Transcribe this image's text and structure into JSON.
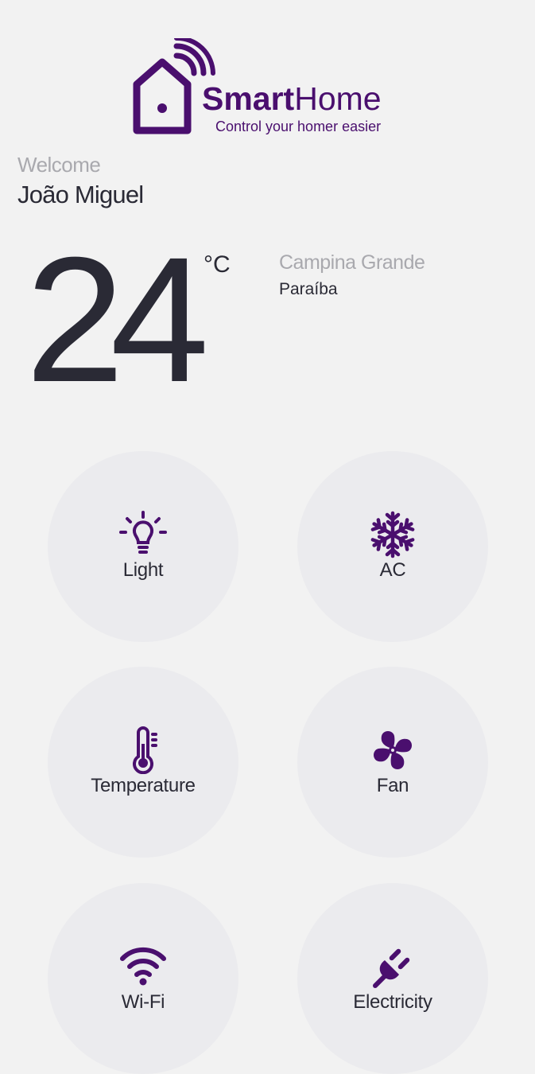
{
  "brand": {
    "name_bold": "Smart",
    "name_light": "Home",
    "tagline": "Control your homer easier",
    "color": "#4a0f6e"
  },
  "greeting": {
    "welcome": "Welcome",
    "user_name": "João Miguel"
  },
  "weather": {
    "temperature": "24",
    "unit": "°C",
    "city": "Campina Grande",
    "state": "Paraíba"
  },
  "devices": [
    {
      "label": "Light",
      "icon": "lightbulb-icon"
    },
    {
      "label": "AC",
      "icon": "snowflake-icon"
    },
    {
      "label": "Temperature",
      "icon": "thermometer-icon"
    },
    {
      "label": "Fan",
      "icon": "fan-icon"
    },
    {
      "label": "Wi-Fi",
      "icon": "wifi-icon"
    },
    {
      "label": "Electricity",
      "icon": "plug-icon"
    }
  ],
  "colors": {
    "accent": "#4a0f6e",
    "background": "#f2f2f2",
    "tile": "#ebebee",
    "text": "#2a2a35",
    "muted": "#a9a9ae"
  }
}
